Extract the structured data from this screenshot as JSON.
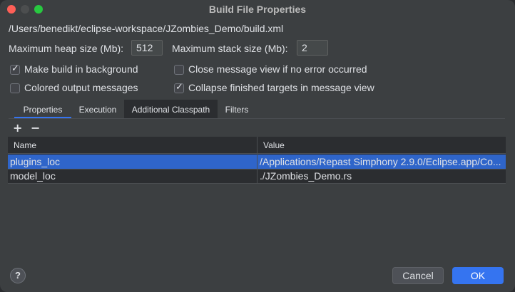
{
  "window": {
    "title": "Build File Properties"
  },
  "file_path": "/Users/benedikt/eclipse-workspace/JZombies_Demo/build.xml",
  "heap": {
    "label": "Maximum heap size (Mb):",
    "value": "512"
  },
  "stack": {
    "label": "Maximum stack size (Mb):",
    "value": "2"
  },
  "options": {
    "make_build_bg": {
      "label": "Make build in background",
      "checked": true
    },
    "close_msg_view": {
      "label": "Close message view if no error occurred",
      "checked": false
    },
    "colored_output": {
      "label": "Colored output messages",
      "checked": false
    },
    "collapse_targets": {
      "label": "Collapse finished targets in message view",
      "checked": true
    }
  },
  "tabs": [
    {
      "label": "Properties",
      "selected": true
    },
    {
      "label": "Execution",
      "selected": false
    },
    {
      "label": "Additional Classpath",
      "selected": false
    },
    {
      "label": "Filters",
      "selected": false
    }
  ],
  "toolbar": {
    "add": "+",
    "remove": "−"
  },
  "table": {
    "headers": [
      "Name",
      "Value"
    ],
    "rows": [
      {
        "name": "plugins_loc",
        "value": "/Applications/Repast Simphony 2.9.0/Eclipse.app/Co...",
        "selected": true
      },
      {
        "name": "model_loc",
        "value": "./JZombies_Demo.rs",
        "selected": false
      }
    ]
  },
  "footer": {
    "help": "?",
    "cancel": "Cancel",
    "ok": "OK"
  },
  "colors": {
    "accent": "#3574f0",
    "selection": "#2f65ca",
    "close": "#ff5f57",
    "maximize": "#28c840"
  }
}
